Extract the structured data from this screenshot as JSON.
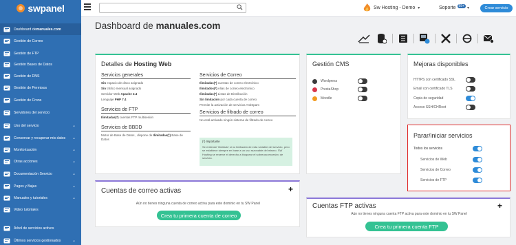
{
  "topbar": {
    "logo_text": "swpanel",
    "search_placeholder": "",
    "user_label": "Sw Hosting - Demo",
    "soporte_label": "Soporte",
    "soporte_badge": "99+",
    "crear_label": "Crear servicio"
  },
  "sidebar": {
    "items": [
      {
        "label": "Dashboard de ",
        "bold": "manuales.com",
        "icon": "dashboard-icon",
        "chevron": false
      },
      {
        "label": "Gestión de Correo",
        "icon": "mail-icon",
        "chevron": false
      },
      {
        "label": "Gestión de FTP",
        "icon": "folder-icon",
        "chevron": false
      },
      {
        "label": "Gestión Bases de Datos",
        "icon": "database-icon",
        "chevron": false
      },
      {
        "label": "Gestión de DNS",
        "icon": "flag-icon",
        "chevron": false
      },
      {
        "label": "Gestión de Permisos",
        "icon": "permissions-icon",
        "chevron": false
      },
      {
        "label": "Gestión de Crons",
        "icon": "cron-icon",
        "chevron": false
      },
      {
        "label": "Servidores del servicio",
        "icon": "server-icon",
        "chevron": false
      },
      {
        "label": "Uso del servicio",
        "icon": "usage-icon",
        "chevron": true
      },
      {
        "label": "Conservar y recuperar mis datos",
        "icon": "backup-icon",
        "chevron": true
      },
      {
        "label": "Monitorización",
        "icon": "monitor-icon",
        "chevron": true
      },
      {
        "label": "Otras acciones",
        "icon": "actions-icon",
        "chevron": true
      },
      {
        "label": "Documentación Servicio",
        "icon": "document-icon",
        "chevron": true
      },
      {
        "label": "Pagos y Bajas",
        "icon": "payments-icon",
        "chevron": true
      },
      {
        "label": "Manuales y tutoriales",
        "icon": "help-icon",
        "chevron": true
      },
      {
        "label": "Video tutoriales",
        "icon": "video-icon",
        "chevron": false
      },
      {
        "label": "Árbol de servicios activos",
        "icon": "tree-icon",
        "chevron": false
      },
      {
        "label": "Últimos servicios gestionados",
        "icon": "history-icon",
        "chevron": true
      }
    ]
  },
  "page": {
    "title_prefix": "Dashboard de ",
    "title_bold": "manuales.com"
  },
  "detalles": {
    "title_prefix": "Detalles de ",
    "title_bold": "Hosting Web",
    "generales_h": "Servicios generales",
    "generales": [
      {
        "b": "Sin",
        "t": " espacio de disco asignado"
      },
      {
        "b": "Sin",
        "t": " tráfico mensual asignado"
      },
      {
        "b": "",
        "t": "Servidor Web ",
        "b2": "Apache 2.4"
      },
      {
        "b": "",
        "t": "Lenguaje ",
        "b2": "PHP 7.4"
      }
    ],
    "ftp_h": "Servicios de FTP",
    "ftp": [
      {
        "b": "Ilimitadas(*)",
        "t": " cuentas FTP multisesión"
      }
    ],
    "bbdd_h": "Servicios de BBDD",
    "bbdd_text": "Motor de Base de Datos , dispone de ",
    "bbdd_bold": "Ilimitadas(*)",
    "bbdd_text2": " Base de Datos",
    "correo_h": "Servicios de Correo",
    "correo": [
      {
        "b": "Ilimitadas(*)",
        "t": " cuentas de correo electrónico"
      },
      {
        "b": "Ilimitados(*)",
        "t": " Alias de correo electrónico"
      },
      {
        "b": "Ilimitadas(*)",
        "t": " Listas de Distribución"
      },
      {
        "b": "Sin limitación",
        "t": " por cada cuenta de correo"
      },
      {
        "b": "",
        "t": "Permite la activación de servicios AntiSpam"
      }
    ],
    "filtrado_h": "Servicios de filtrado de correo",
    "filtrado_text": "No está activado ningún sistema de filtrado de correo",
    "info_title": "(*) Importante",
    "info_text": "Se entiende 'ilimitado' si no limitación de esta variable del servicio, pero se establece siempre en base a un uso razonable del mismo. SW Hosting se reserve el derecho a bloquear el sobreuso excesivo de servicio."
  },
  "cms": {
    "title": "Gestión CMS",
    "items": [
      {
        "label": "Wordpress",
        "color": "#3c3c3c",
        "on": false
      },
      {
        "label": "PrestaShop",
        "color": "#d8364a",
        "on": false
      },
      {
        "label": "Moodle",
        "color": "#f29b20",
        "on": false
      }
    ]
  },
  "mejoras": {
    "title": "Mejoras disponibles",
    "items": [
      {
        "label": "HTTPS con certificado SSL",
        "on": false
      },
      {
        "label": "Email con certificado TLS",
        "on": false
      },
      {
        "label": "Copia de seguridad",
        "on": true
      },
      {
        "label": "Acceso SSH/CHRoot",
        "on": false
      }
    ]
  },
  "parar": {
    "title": "Parar/iniciar servicios",
    "todos": "Todos los servicios",
    "items": [
      {
        "label": "Servicios de Web",
        "on": true
      },
      {
        "label": "Servicios de Correo",
        "on": true
      },
      {
        "label": "Servicios de FTP",
        "on": true
      }
    ]
  },
  "correo_card": {
    "title": "Cuentas de correo activas",
    "empty_text": "Aún no tienes ninguna cuenta de correo activa para este dominio en tu SW Panel",
    "button": "Crea tu primera cuenta de correo"
  },
  "ftp_card": {
    "title": "Cuentas FTP activas",
    "empty_text": "Aún no tienes ninguna cuenta FTP activa para este dominio en tu SW Panel",
    "button": "Crea tu primera cuenta FTP"
  },
  "colors": {
    "sidebar": "#2f6fb3",
    "accent_green": "#34c293",
    "accent_blue": "#2e8bd8",
    "highlight_red": "#e02b2b"
  }
}
